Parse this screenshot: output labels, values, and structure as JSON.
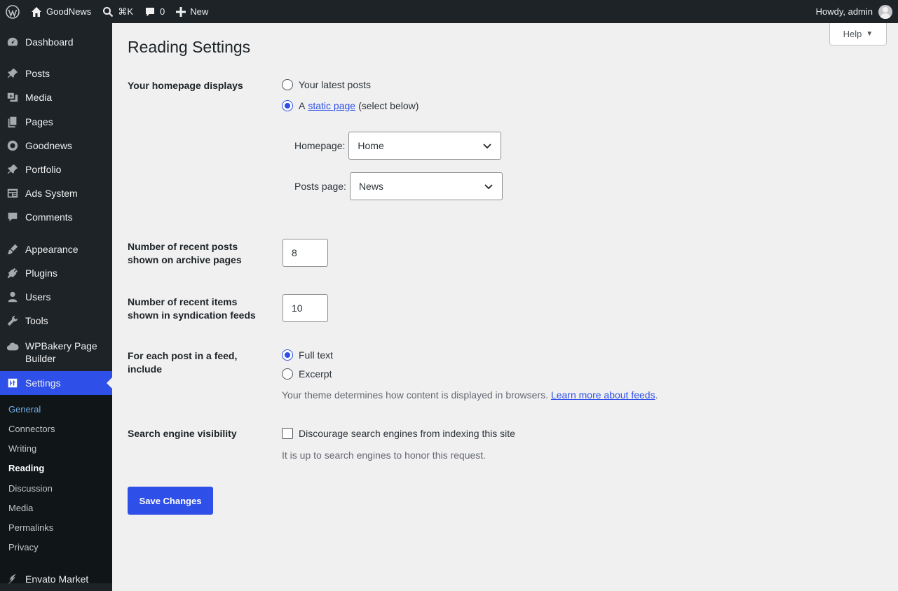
{
  "adminbar": {
    "site_name": "GoodNews",
    "search_shortcut": "⌘K",
    "comments_count": "0",
    "new_label": "New",
    "howdy": "Howdy, admin"
  },
  "sidebar": {
    "items": [
      {
        "label": "Dashboard",
        "icon": "dashboard-icon"
      },
      {
        "label": "Posts",
        "icon": "pin-icon"
      },
      {
        "label": "Media",
        "icon": "media-icon"
      },
      {
        "label": "Pages",
        "icon": "pages-icon"
      },
      {
        "label": "Goodnews",
        "icon": "goodnews-icon"
      },
      {
        "label": "Portfolio",
        "icon": "pin-icon"
      },
      {
        "label": "Ads System",
        "icon": "ads-icon"
      },
      {
        "label": "Comments",
        "icon": "comment-icon"
      },
      {
        "label": "Appearance",
        "icon": "brush-icon"
      },
      {
        "label": "Plugins",
        "icon": "plugin-icon"
      },
      {
        "label": "Users",
        "icon": "user-icon"
      },
      {
        "label": "Tools",
        "icon": "wrench-icon"
      },
      {
        "label": "WPBakery Page Builder",
        "icon": "cloud-icon"
      },
      {
        "label": "Settings",
        "icon": "settings-icon"
      },
      {
        "label": "Envato Market",
        "icon": "envato-icon"
      }
    ],
    "submenu": [
      "General",
      "Connectors",
      "Writing",
      "Reading",
      "Discussion",
      "Media",
      "Permalinks",
      "Privacy"
    ]
  },
  "main": {
    "help_label": "Help",
    "title": "Reading Settings",
    "homepage_displays": {
      "label": "Your homepage displays",
      "option_latest": "Your latest posts",
      "option_static_prefix": "A",
      "option_static_link": "static page",
      "option_static_suffix": "(select below)",
      "homepage_label": "Homepage:",
      "homepage_value": "Home",
      "posts_page_label": "Posts page:",
      "posts_page_value": "News"
    },
    "archive_posts": {
      "label_line1": "Number of recent posts",
      "label_line2": "shown on archive pages",
      "value": "8"
    },
    "feed_items": {
      "label_line1": "Number of recent items",
      "label_line2": "shown in syndication feeds",
      "value": "10"
    },
    "feed_include": {
      "label_line1": "For each post in a feed,",
      "label_line2": "include",
      "option_full": "Full text",
      "option_excerpt": "Excerpt",
      "desc": "Your theme determines how content is displayed in browsers.",
      "desc_link": "Learn more about feeds",
      "desc_end": "."
    },
    "search_visibility": {
      "label": "Search engine visibility",
      "checkbox_label": "Discourage search engines from indexing this site",
      "desc": "It is up to search engines to honor this request."
    },
    "save_label": "Save Changes"
  },
  "colors": {
    "accent": "#2e4fe8",
    "sidebar_bg": "#1d2327",
    "page_bg": "#f0f0f1"
  }
}
